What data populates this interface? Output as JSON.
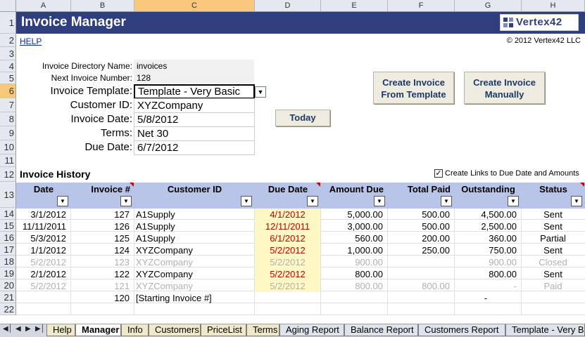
{
  "columns": [
    "A",
    "B",
    "C",
    "D",
    "E",
    "F",
    "G",
    "H"
  ],
  "rows": [
    "1",
    "2",
    "3",
    "4",
    "5",
    "6",
    "7",
    "8",
    "9",
    "10",
    "11",
    "12",
    "13",
    "14",
    "15",
    "16",
    "17",
    "18",
    "19",
    "20",
    "21",
    "22"
  ],
  "header": {
    "title": "Invoice Manager",
    "logo": "Vertex42",
    "help_link": "HELP",
    "copyright": "© 2012 Vertex42 LLC"
  },
  "form": {
    "dir_label": "Invoice Directory Name:",
    "dir_value": "invoices",
    "next_label": "Next Invoice Number:",
    "next_value": "128",
    "template_label": "Invoice  Template:",
    "template_value": "Template - Very Basic",
    "customer_label": "Customer ID:",
    "customer_value": "XYZCompany",
    "date_label": "Invoice Date:",
    "date_value": "5/8/2012",
    "terms_label": "Terms:",
    "terms_value": "Net 30",
    "due_label": "Due Date:",
    "due_value": "6/7/2012"
  },
  "buttons": {
    "create_from_template": [
      "Create Invoice",
      "From Template"
    ],
    "create_manually": [
      "Create Invoice",
      "Manually"
    ],
    "today": "Today"
  },
  "history": {
    "title": "Invoice History",
    "checkbox_label": "Create Links to Due Date and Amounts",
    "checkbox_checked": true,
    "headers": [
      "Date",
      "Invoice #",
      "Customer ID",
      "Due Date",
      "Amount Due",
      "Total Paid",
      "Outstanding",
      "Status"
    ],
    "rows": [
      {
        "date": "3/1/2012",
        "inv": "127",
        "cust": "A1Supply",
        "due": "4/1/2012",
        "amt": "5,000.00",
        "paid": "500.00",
        "out": "4,500.00",
        "status": "Sent",
        "style": "normal"
      },
      {
        "date": "11/11/2011",
        "inv": "126",
        "cust": "A1Supply",
        "due": "12/11/2011",
        "amt": "3,000.00",
        "paid": "500.00",
        "out": "2,500.00",
        "status": "Sent",
        "style": "normal"
      },
      {
        "date": "5/3/2012",
        "inv": "125",
        "cust": "A1Supply",
        "due": "6/1/2012",
        "amt": "560.00",
        "paid": "200.00",
        "out": "360.00",
        "status": "Partial",
        "style": "normal"
      },
      {
        "date": "1/1/2012",
        "inv": "124",
        "cust": "XYZCompany",
        "due": "5/2/2012",
        "amt": "1,000.00",
        "paid": "250.00",
        "out": "750.00",
        "status": "Sent",
        "style": "normal"
      },
      {
        "date": "5/2/2012",
        "inv": "123",
        "cust": "XYZCompany",
        "due": "5/2/2012",
        "amt": "900.00",
        "paid": "",
        "out": "900.00",
        "status": "Closed",
        "style": "grey"
      },
      {
        "date": "2/1/2012",
        "inv": "122",
        "cust": "XYZCompany",
        "due": "5/2/2012",
        "amt": "800.00",
        "paid": "",
        "out": "800.00",
        "status": "Sent",
        "style": "normal"
      },
      {
        "date": "5/2/2012",
        "inv": "121",
        "cust": "XYZCompany",
        "due": "5/2/2012",
        "amt": "800.00",
        "paid": "800.00",
        "out": "-",
        "status": "Paid",
        "style": "grey"
      },
      {
        "date": "",
        "inv": "120",
        "cust": "[Starting Invoice #]",
        "due": "",
        "amt": "",
        "paid": "",
        "out": "-",
        "status": "",
        "style": "normal"
      }
    ]
  },
  "sheet_tabs": [
    "Help",
    "Manager",
    "Info",
    "Customers",
    "PriceList",
    "Terms",
    "Aging Report",
    "Balance Report",
    "Customers Report",
    "Template - Very B"
  ],
  "active_tab": "Manager",
  "colors": {
    "title_bg": "#2f3f7e",
    "header_bg": "#b8c4e8",
    "due_highlight": "#fff7c4",
    "overdue_text": "#c00000",
    "selection": "#f8c77b"
  }
}
